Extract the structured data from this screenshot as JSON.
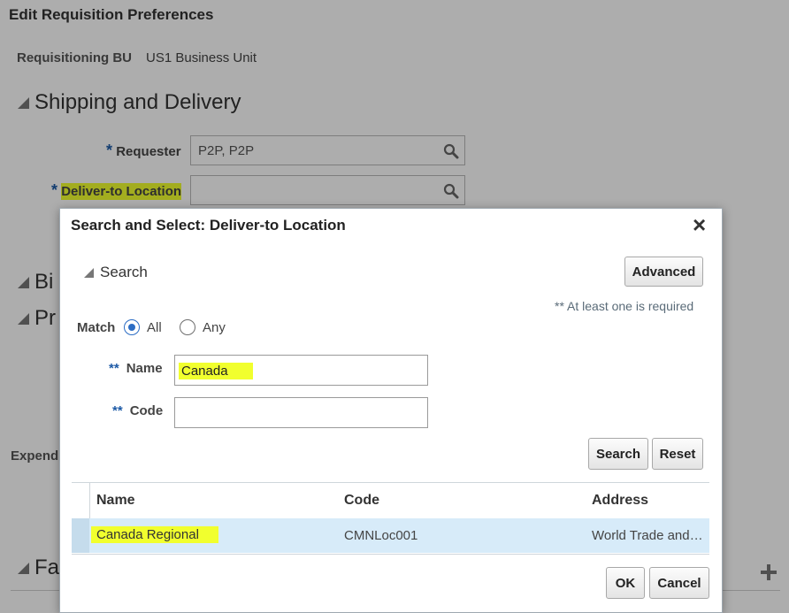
{
  "page": {
    "title": "Edit Requisition Preferences",
    "bu_label": "Requisitioning BU",
    "bu_value": "US1 Business Unit",
    "shipping_section": "Shipping and Delivery",
    "required_star": "*",
    "requester_label": "Requester",
    "requester_value": "P2P, P2P",
    "deliver_label": "Deliver-to Location",
    "deliver_value": "",
    "billing_partial": "Bi",
    "project_partial": "Pr",
    "expenditure_partial": "Expend",
    "favorites_partial": "Fa",
    "add_icon": "plus-icon"
  },
  "dialog": {
    "title": "Search and Select: Deliver-to Location",
    "close_symbol": "×",
    "search_section": "Search",
    "advanced_label": "Advanced",
    "required_note": "** At least one is required",
    "match_label": "Match",
    "match_options": [
      "All",
      "Any"
    ],
    "match_selected": "All",
    "double_star": "**",
    "name_label": "Name",
    "name_value": "Canada",
    "code_label": "Code",
    "code_value": "",
    "search_button": "Search",
    "reset_button": "Reset",
    "table": {
      "headers": [
        "Name",
        "Code",
        "Address"
      ],
      "rows": [
        {
          "name": "Canada Regional",
          "code": "CMNLoc001",
          "address": "World Trade and…"
        }
      ]
    },
    "ok_button": "OK",
    "cancel_button": "Cancel"
  },
  "colors": {
    "highlight": "#f1ff2e",
    "selected_row": "#d7ebf9",
    "accent_blue": "#2b6cc4",
    "overlay": "rgba(0,0,0,0.32)"
  }
}
